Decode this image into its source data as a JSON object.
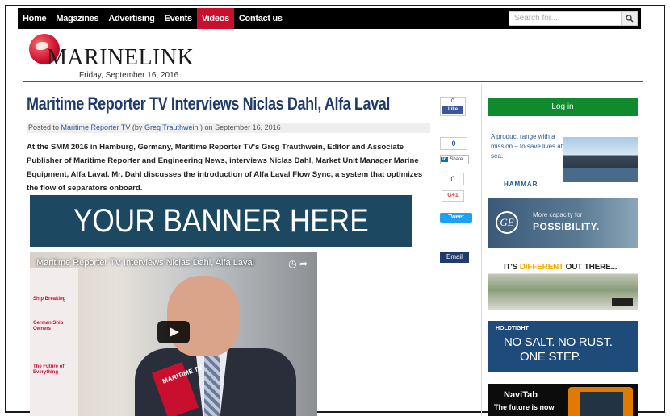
{
  "nav": {
    "items": [
      {
        "label": "Home",
        "active": false
      },
      {
        "label": "Magazines",
        "active": false
      },
      {
        "label": "Advertising",
        "active": false
      },
      {
        "label": "Events",
        "active": false
      },
      {
        "label": "Videos",
        "active": true
      },
      {
        "label": "Contact us",
        "active": false
      }
    ],
    "search_placeholder": "Search for..."
  },
  "header": {
    "logo_text": "MARINELINK",
    "date": "Friday, September 16, 2016"
  },
  "article": {
    "title": "Maritime Reporter TV Interviews Niclas Dahl, Alfa Laval",
    "byline_prefix": "Posted to",
    "byline_category": "Maritime Reporter TV",
    "byline_by": "(by",
    "byline_author": "Greg Trauthwein",
    "byline_close": ")",
    "byline_on": "on",
    "byline_date": "September 16, 2016",
    "body": "At the SMM 2016 in Hamburg, Germany, Maritime Reporter TV's Greg Trauthwein, Editor and Associate Publisher of Maritime Reporter and Engineering News, interviews Niclas Dahl, Market Unit Manager Marine Equipment, Alfa Laval. Mr. Dahl discusses the introduction of Alfa Laval Flow Sync, a system that optimizes the flow of separators onboard."
  },
  "banner": {
    "text": "YOUR BANNER HERE"
  },
  "video": {
    "title": "Maritime Reporter TV Interviews Niclas Dahl, Alfa Laval",
    "mic_label": "MARITIME TV",
    "poster_lines": [
      "Ship Breaking",
      "German Ship Owners",
      "The Future of Everything"
    ]
  },
  "social": {
    "fb_count": "0",
    "fb_label": "Like",
    "li_count": "0",
    "li_label": "Share",
    "gp_count": "0",
    "gp_label": "G+1",
    "tw_label": "Tweet",
    "email_label": "Email"
  },
  "sidebar": {
    "login_label": "Log in",
    "hammar_text": "A product range with a mission – to save lives at sea.",
    "hammar_brand": "HAMMAR",
    "ge_logo": "GE",
    "ge_line1": "More capacity for",
    "ge_line2": "POSSIBILITY.",
    "diff_pre": "IT'S",
    "diff_em": "DIFFERENT",
    "diff_post": "OUT THERE...",
    "ht_brand": "HOLDTIGHT",
    "ht_line1": "NO SALT. NO RUST.",
    "ht_line2": "ONE STEP.",
    "nt_brand": "NaviTab",
    "nt_line": "The future is now"
  }
}
